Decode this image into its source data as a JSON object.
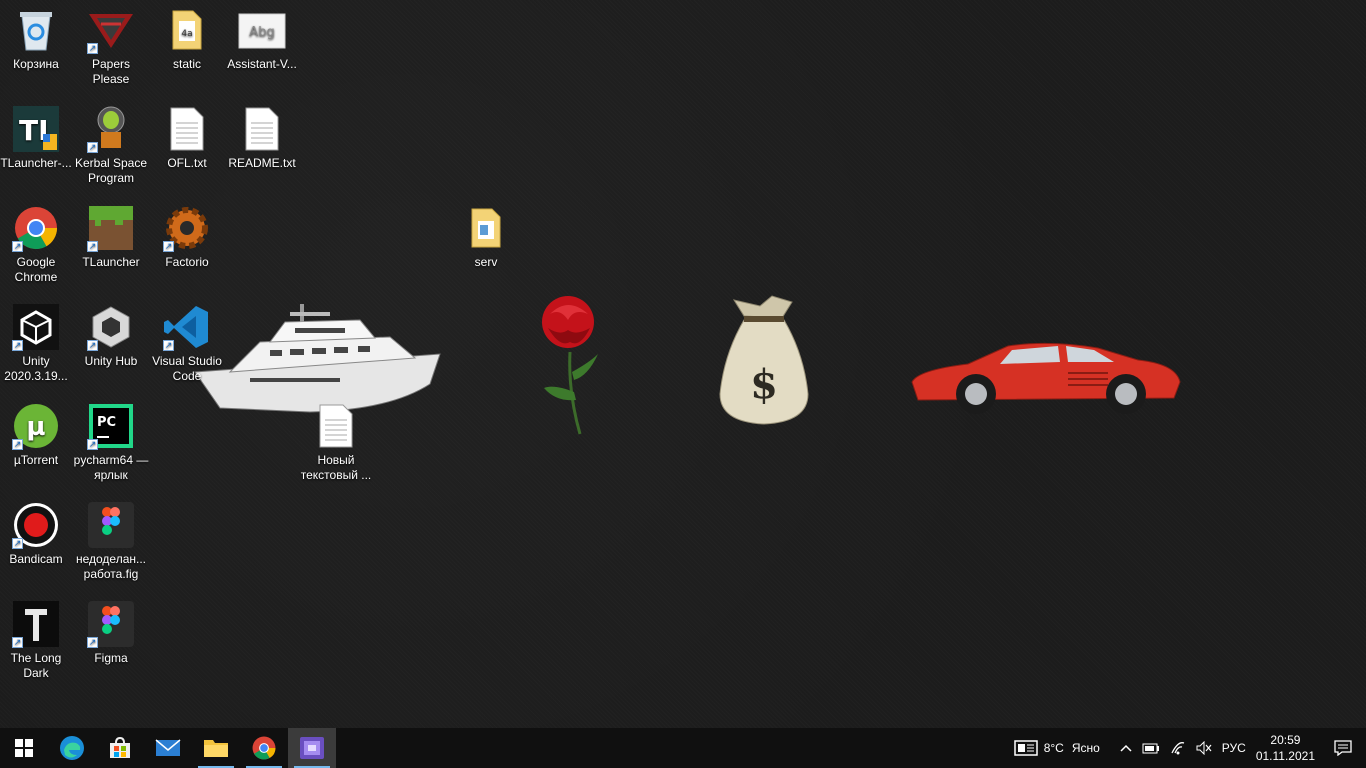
{
  "desktop": {
    "icons": [
      {
        "label": "Корзина",
        "icon": "recycle-bin-icon",
        "shortcut": false
      },
      {
        "label": "Papers Please",
        "icon": "papers-please-icon",
        "shortcut": true
      },
      {
        "label": "static",
        "icon": "folder-icon",
        "shortcut": false
      },
      {
        "label": "Assistant-V...",
        "icon": "font-file-icon",
        "shortcut": false
      },
      {
        "label": "TLauncher-...",
        "icon": "tlauncher-installer-icon",
        "shortcut": false
      },
      {
        "label": "Kerbal Space Program",
        "icon": "kerbal-space-program-icon",
        "shortcut": true
      },
      {
        "label": "OFL.txt",
        "icon": "text-file-icon",
        "shortcut": false
      },
      {
        "label": "README.txt",
        "icon": "text-file-icon",
        "shortcut": false
      },
      {
        "label": "Google Chrome",
        "icon": "chrome-icon",
        "shortcut": true
      },
      {
        "label": "TLauncher",
        "icon": "tlauncher-icon",
        "shortcut": true
      },
      {
        "label": "Factorio",
        "icon": "factorio-icon",
        "shortcut": true
      },
      {
        "label": "serv",
        "icon": "folder-icon",
        "shortcut": false
      },
      {
        "label": "Unity 2020.3.19...",
        "icon": "unity-icon",
        "shortcut": true
      },
      {
        "label": "Unity Hub",
        "icon": "unity-hub-icon",
        "shortcut": true
      },
      {
        "label": "Visual Studio Code",
        "icon": "vscode-icon",
        "shortcut": true
      },
      {
        "label": "Новый текстовый ...",
        "icon": "text-file-icon",
        "shortcut": false
      },
      {
        "label": "µTorrent",
        "icon": "utorrent-icon",
        "shortcut": true
      },
      {
        "label": "pycharm64 — ярлык",
        "icon": "pycharm-icon",
        "shortcut": true
      },
      {
        "label": "Bandicam",
        "icon": "bandicam-icon",
        "shortcut": true
      },
      {
        "label": "недоделан... работа.fig",
        "icon": "figma-file-icon",
        "shortcut": false
      },
      {
        "label": "The Long Dark",
        "icon": "the-long-dark-icon",
        "shortcut": true
      },
      {
        "label": "Figma",
        "icon": "figma-icon",
        "shortcut": true
      }
    ],
    "wallpaper_images": [
      "yacht-image",
      "rose-image",
      "money-bag-image",
      "red-sports-car-image"
    ]
  },
  "taskbar": {
    "apps": [
      {
        "name": "start-button",
        "icon": "windows-logo-icon"
      },
      {
        "name": "edge-taskbar",
        "icon": "edge-icon"
      },
      {
        "name": "store-taskbar",
        "icon": "store-icon"
      },
      {
        "name": "mail-taskbar",
        "icon": "mail-icon"
      },
      {
        "name": "explorer-taskbar",
        "icon": "folder-icon"
      },
      {
        "name": "chrome-taskbar",
        "icon": "chrome-icon"
      },
      {
        "name": "app-taskbar-active",
        "icon": "app-icon"
      }
    ],
    "weather": {
      "temp": "8°C",
      "condition": "Ясно"
    },
    "language": "РУС",
    "clock": {
      "time": "20:59",
      "date": "01.11.2021"
    }
  }
}
